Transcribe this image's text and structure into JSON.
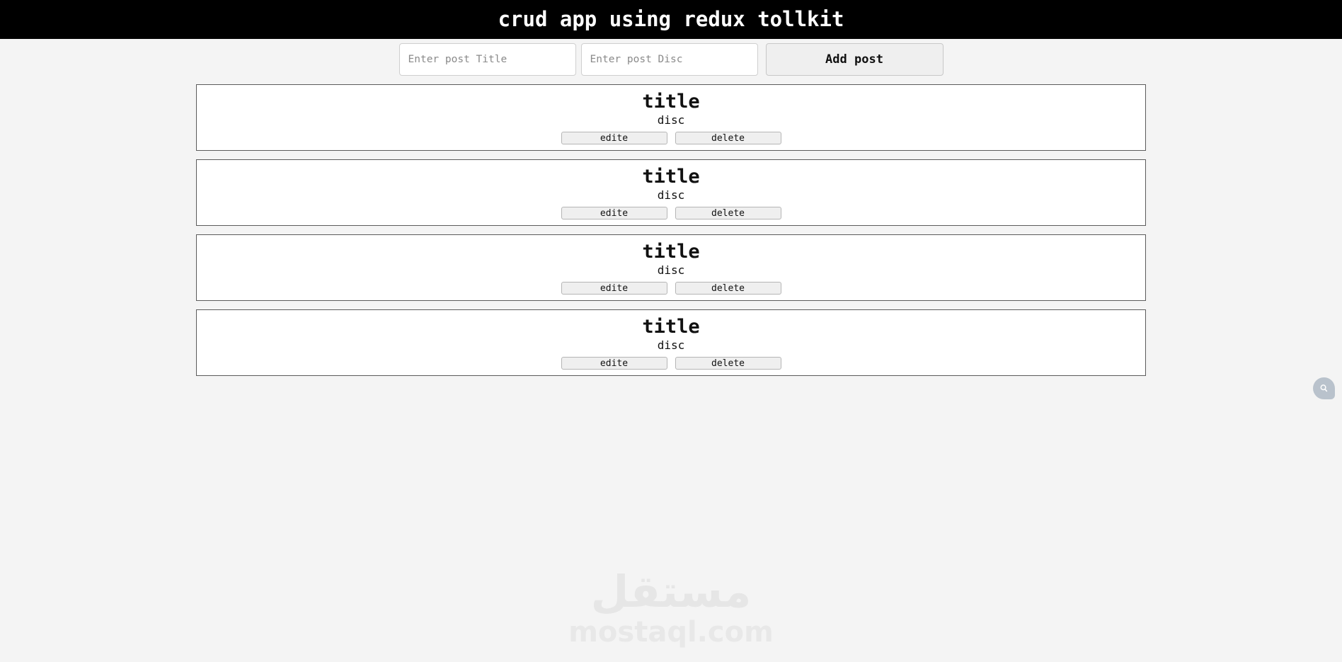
{
  "header": {
    "title": "crud app using redux tollkit",
    "background_color": "#000000",
    "text_color": "#ffffff"
  },
  "form": {
    "title_input": {
      "placeholder": "Enter post Title",
      "value": ""
    },
    "disc_input": {
      "placeholder": "Enter post Disc",
      "value": ""
    },
    "add_button_label": "Add post"
  },
  "posts": [
    {
      "title": "title",
      "disc": "disc",
      "edit_label": "edite",
      "delete_label": "delete"
    },
    {
      "title": "title",
      "disc": "disc",
      "edit_label": "edite",
      "delete_label": "delete"
    },
    {
      "title": "title",
      "disc": "disc",
      "edit_label": "edite",
      "delete_label": "delete"
    },
    {
      "title": "title",
      "disc": "disc",
      "edit_label": "edite",
      "delete_label": "delete"
    }
  ],
  "watermark": {
    "arabic": "مستقل",
    "latin": "mostaql.com",
    "color": "#e6e6e6"
  },
  "support_widget": {
    "icon": "search-bubble-icon",
    "color": "#b9c2cc"
  },
  "page": {
    "background_color": "#f4f4f4",
    "card_border_color": "#5b5b5b",
    "card_background": "#ffffff",
    "button_background": "#efefef"
  }
}
